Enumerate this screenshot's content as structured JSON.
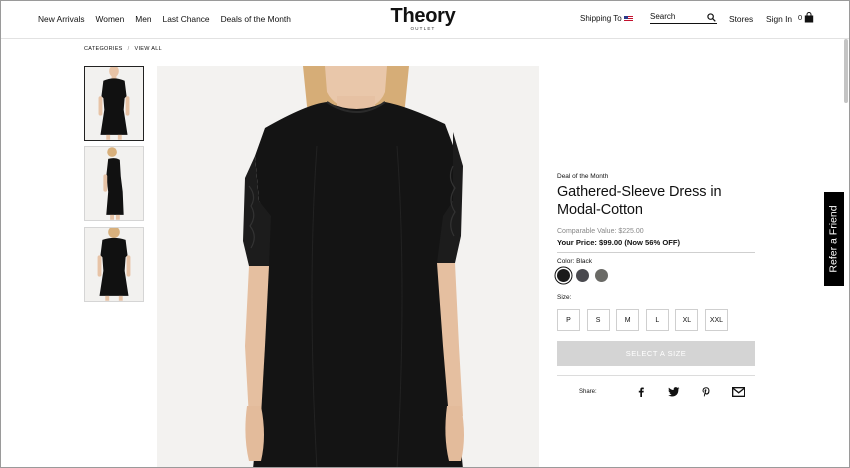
{
  "header": {
    "nav": [
      "New Arrivals",
      "Women",
      "Men",
      "Last Chance",
      "Deals of the Month"
    ],
    "logo": {
      "main": "Theory",
      "sub": "OUTLET"
    },
    "shipping_label": "Shipping To",
    "search_placeholder": "Search",
    "stores": "Stores",
    "sign_in": "Sign In",
    "cart_count": "0"
  },
  "breadcrumb": {
    "first": "CATEGORIES",
    "separator": "/",
    "second": "VIEW ALL"
  },
  "product": {
    "deal_label": "Deal of the Month",
    "title": "Gathered-Sleeve Dress in Modal-Cotton",
    "comparable": "Comparable Value: $225.00",
    "your_price": "Your Price: $99.00 (Now 56% OFF)",
    "color_label": "Color:",
    "color_value": "Black",
    "swatches": [
      {
        "name": "Black",
        "hex": "#1b1b1b"
      },
      {
        "name": "Charcoal",
        "hex": "#4a4a4f"
      },
      {
        "name": "Grey",
        "hex": "#6a6a66"
      }
    ],
    "size_label": "Size:",
    "sizes": [
      "P",
      "S",
      "M",
      "L",
      "XL",
      "XXL"
    ],
    "cta": "SELECT A SIZE",
    "share_label": "Share:"
  },
  "refer": "Refer a Friend",
  "colors": {
    "dress": "#111111",
    "skin": "#e7c3a6",
    "hair": "#d8b07c",
    "bg_photo": "#f3f2f0"
  }
}
